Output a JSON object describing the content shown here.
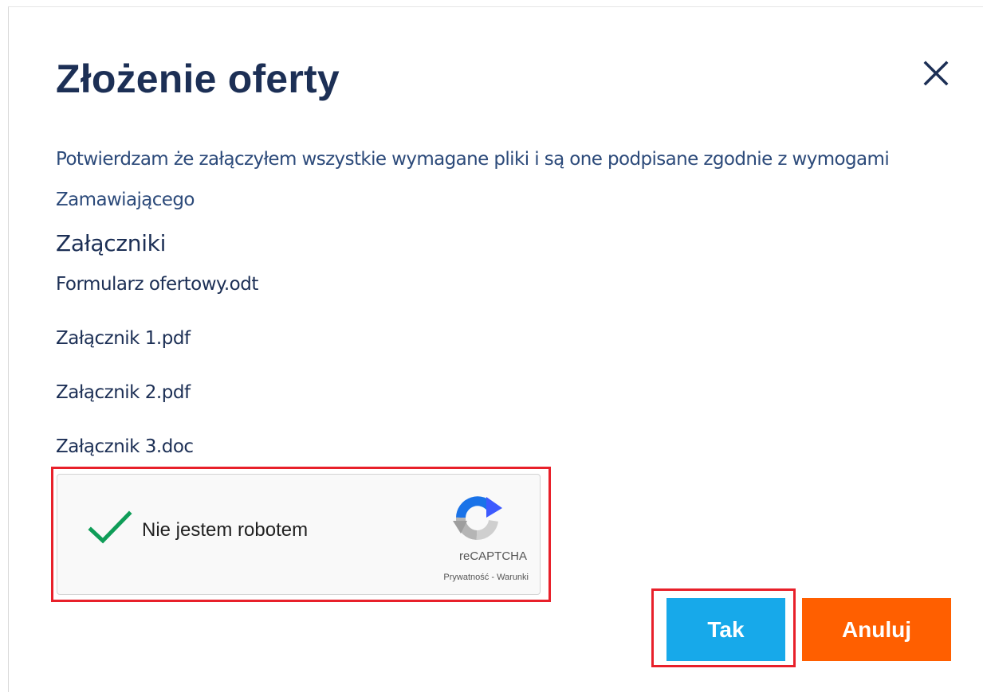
{
  "dialog": {
    "title": "Złożenie oferty",
    "close_icon": "close-icon",
    "confirmation_text": "Potwierdzam że załączyłem wszystkie wymagane pliki i są one podpisane zgodnie z wymogami Zamawiającego"
  },
  "attachments": {
    "heading": "Załączniki",
    "files": [
      "Formularz ofertowy.odt",
      "Załącznik 1.pdf",
      "Załącznik 2.pdf",
      "Załącznik 3.doc"
    ]
  },
  "captcha": {
    "checked": true,
    "label": "Nie jestem robotem",
    "brand": "reCAPTCHA",
    "privacy_link": "Prywatność",
    "separator": " - ",
    "terms_link": "Warunki",
    "check_icon": "checkmark-icon",
    "logo_icon": "recaptcha-logo-icon"
  },
  "buttons": {
    "confirm_label": "Tak",
    "cancel_label": "Anuluj"
  },
  "colors": {
    "title": "#1c2f55",
    "text": "#2c4a7a",
    "confirm_button": "#17a9ea",
    "cancel_button": "#ff5f00",
    "highlight": "#e8202a",
    "check": "#0f9d58"
  }
}
